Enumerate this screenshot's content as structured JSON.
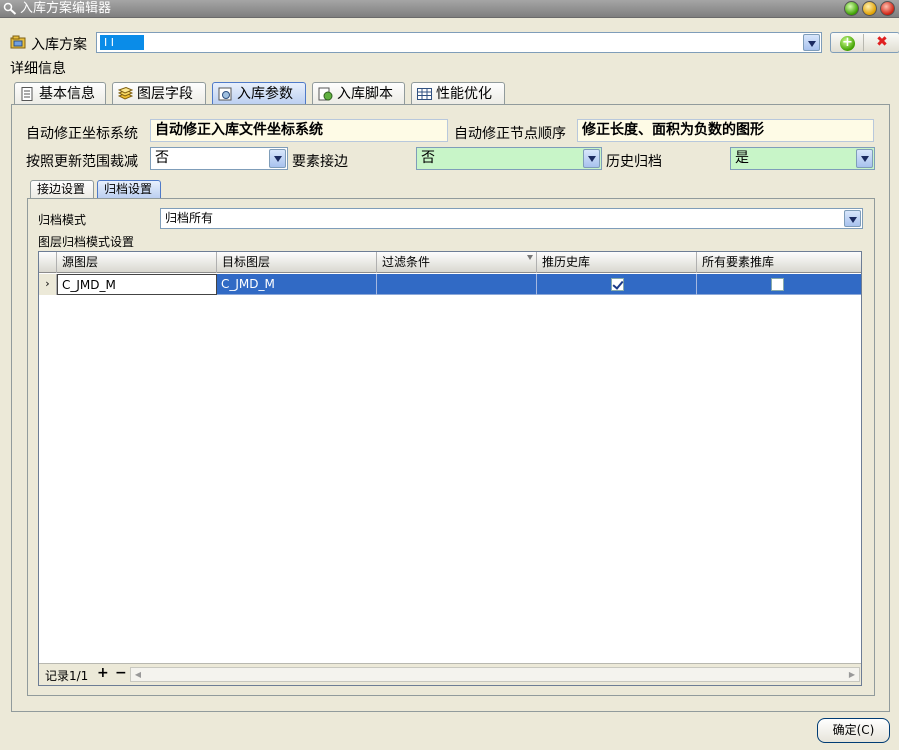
{
  "window": {
    "title": "入库方案编辑器"
  },
  "scheme": {
    "label": "入库方案",
    "value": "I      I"
  },
  "detail": {
    "label": "详细信息"
  },
  "tabs": [
    {
      "label": "基本信息",
      "icon": "document-icon"
    },
    {
      "label": "图层字段",
      "icon": "layers-icon"
    },
    {
      "label": "入库参数",
      "icon": "parameters-icon"
    },
    {
      "label": "入库脚本",
      "icon": "script-icon"
    },
    {
      "label": "性能优化",
      "icon": "grid-icon"
    }
  ],
  "params": {
    "auto_coord_label": "自动修正坐标系统",
    "auto_coord_value": "自动修正入库文件坐标系统",
    "auto_node_label": "自动修正节点顺序",
    "auto_node_value": "修正长度、面积为负数的图形",
    "clip_label": "按照更新范围裁减",
    "clip_value": "否",
    "edge_label": "要素接边",
    "edge_value": "否",
    "history_label": "历史归档",
    "history_value": "是"
  },
  "subtabs": [
    {
      "label": "接边设置"
    },
    {
      "label": "归档设置"
    }
  ],
  "archive": {
    "mode_label": "归档模式",
    "mode_value": "归档所有",
    "grid_label": "图层归档模式设置"
  },
  "grid": {
    "columns": [
      "源图层",
      "目标图层",
      "过滤条件",
      "推历史库",
      "所有要素推库"
    ],
    "rows": [
      {
        "source": "C_JMD_M",
        "target": "C_JMD_M",
        "filter": "",
        "push_history": true,
        "push_all": false
      }
    ],
    "record_label": "记录1/1",
    "add_symbol": "+",
    "remove_symbol": "−"
  },
  "footer": {
    "ok_label": "确定(C)"
  },
  "colors": {
    "selection": "#316ac5",
    "readonly_yellow": "#fefbe6",
    "combo_green": "#c8f5c8"
  }
}
